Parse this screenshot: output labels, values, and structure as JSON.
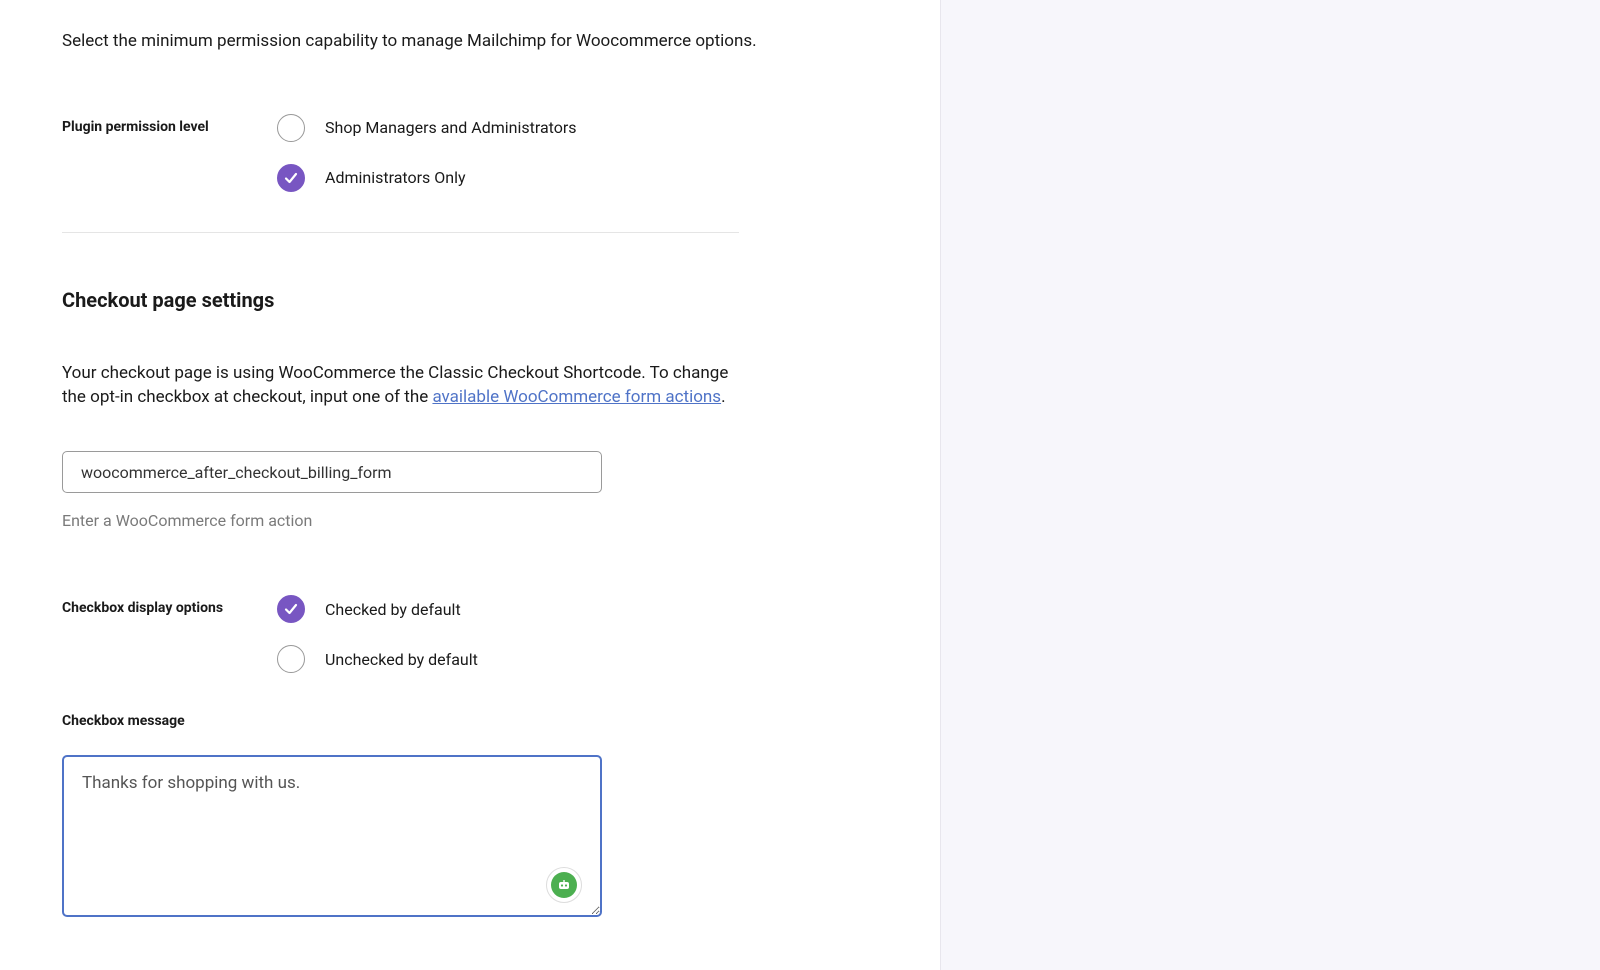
{
  "permission": {
    "intro": "Select the minimum permission capability to manage Mailchimp for Woocommerce options.",
    "label": "Plugin permission level",
    "options": {
      "shop_managers": "Shop Managers and Administrators",
      "admin_only": "Administrators Only"
    },
    "selected": "admin_only"
  },
  "checkout": {
    "heading": "Checkout page settings",
    "desc_part1": "Your checkout page is using WooCommerce the Classic Checkout Shortcode. To change the opt-in checkbox at checkout, input one of the ",
    "desc_link_text": "available WooCommerce form actions",
    "desc_part2": ".",
    "form_action_value": "woocommerce_after_checkout_billing_form",
    "form_action_helper": "Enter a WooCommerce form action"
  },
  "checkbox_display": {
    "label": "Checkbox display options",
    "options": {
      "checked": "Checked by default",
      "unchecked": "Unchecked by default"
    },
    "selected": "checked"
  },
  "checkbox_message": {
    "label": "Checkbox message",
    "value": "Thanks for shopping with us."
  }
}
